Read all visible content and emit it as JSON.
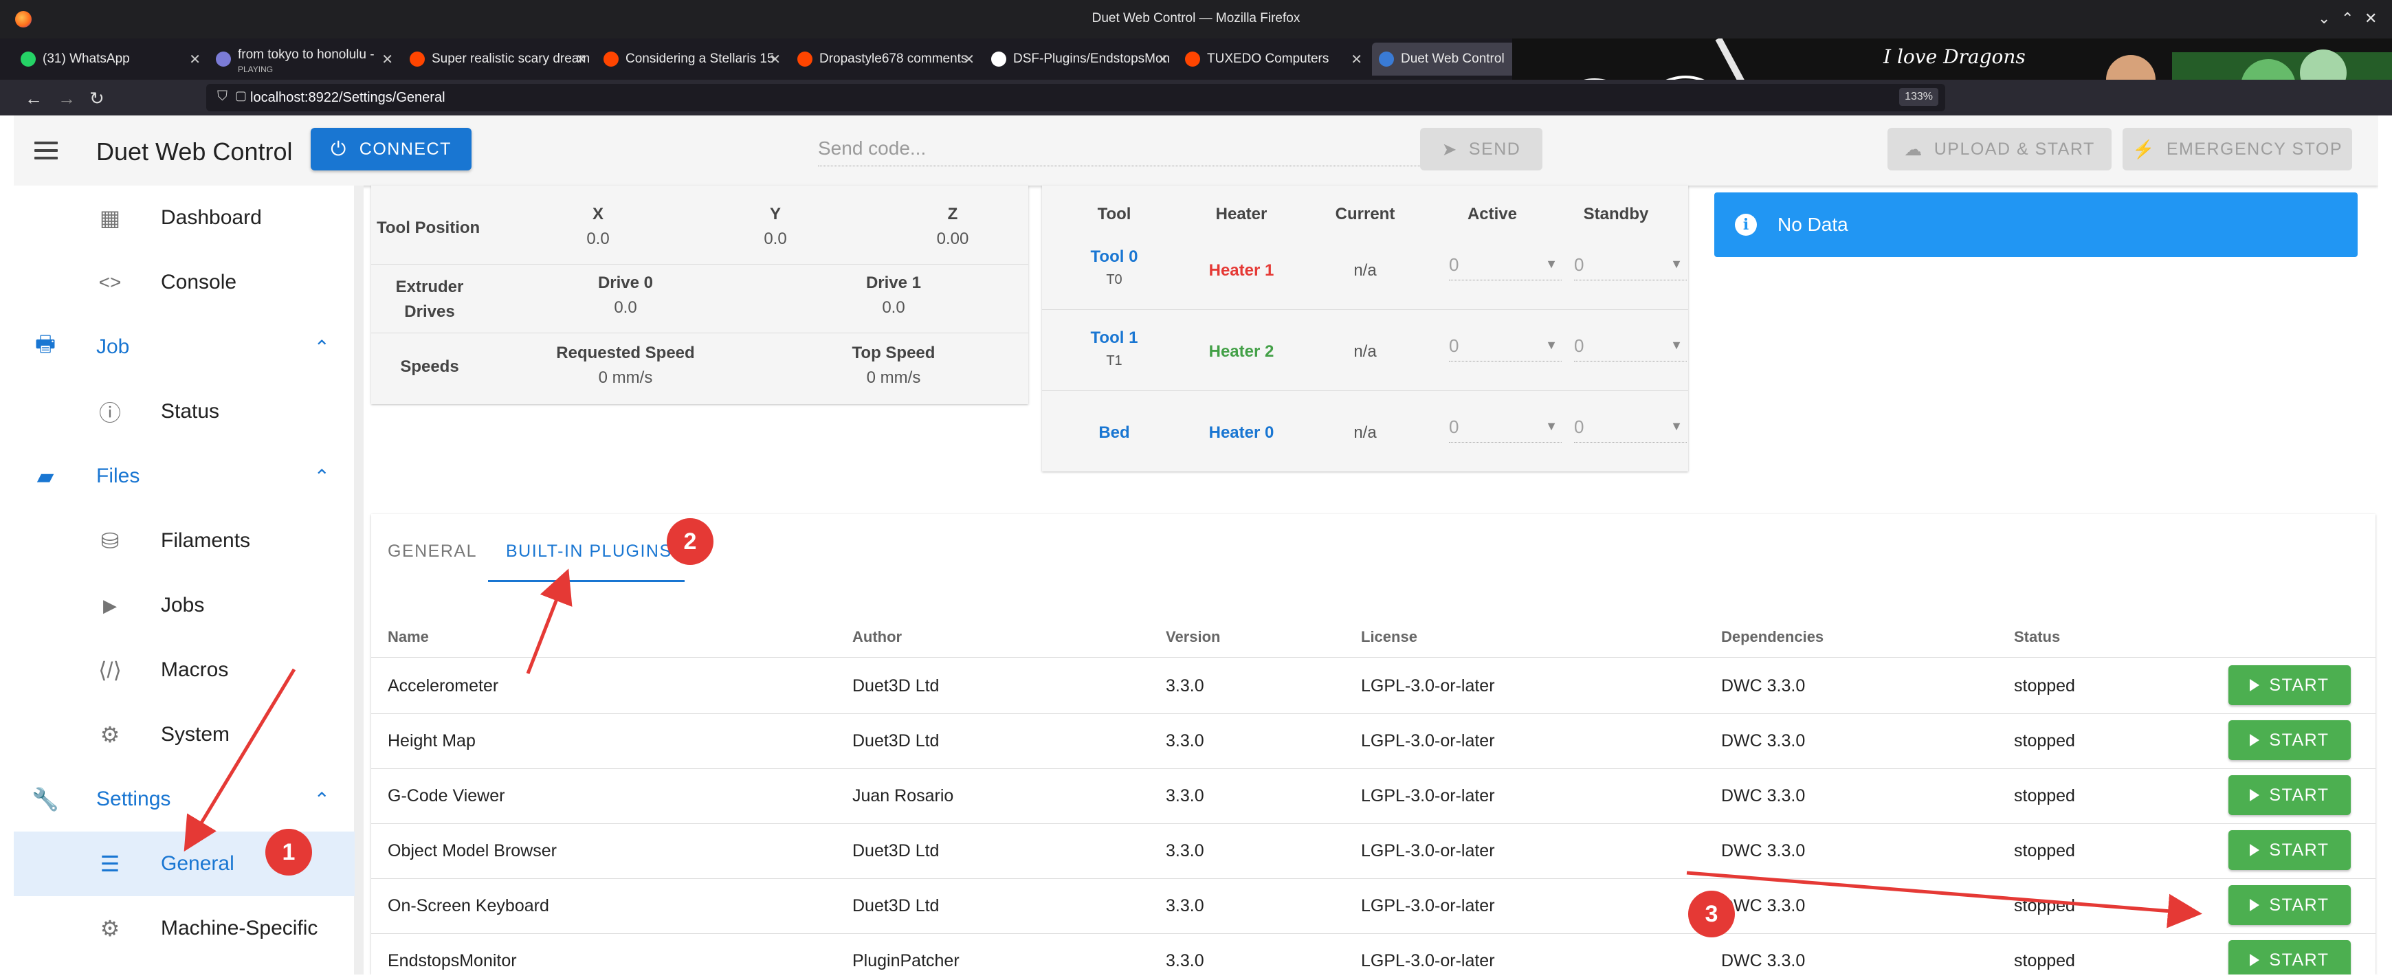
{
  "window": {
    "title": "Duet Web Control — Mozilla Firefox"
  },
  "tabs": [
    {
      "title": "(31) WhatsApp",
      "color": "#25d366"
    },
    {
      "title": "from tokyo to honolulu -",
      "sub": "PLAYING",
      "color": "#7b7bd6"
    },
    {
      "title": "Super realistic scary dream",
      "color": "#ff4500"
    },
    {
      "title": "Considering a Stellaris 15",
      "color": "#ff4500"
    },
    {
      "title": "Dropastyle678 comments",
      "color": "#ff4500"
    },
    {
      "title": "DSF-Plugins/EndstopsMon",
      "color": "#ffffff"
    },
    {
      "title": "TUXEDO Computers",
      "color": "#ff4500"
    },
    {
      "title": "Duet Web Control",
      "color": "#3a7bd5"
    }
  ],
  "banner_text": "I love Dragons",
  "url": "localhost:8922/Settings/General",
  "zoom": "133%",
  "app": {
    "title": "Duet Web Control",
    "connect_label": "CONNECT",
    "send_placeholder": "Send code...",
    "send_label": "SEND",
    "upload_label": "UPLOAD & START",
    "estop_label": "EMERGENCY STOP"
  },
  "sidebar": {
    "dashboard": "Dashboard",
    "console": "Console",
    "job": "Job",
    "status": "Status",
    "files": "Files",
    "filaments": "Filaments",
    "jobs": "Jobs",
    "macros": "Macros",
    "system": "System",
    "settings": "Settings",
    "general": "General",
    "machine_specific": "Machine-Specific"
  },
  "movement": {
    "tool_position": "Tool Position",
    "x": "X",
    "y": "Y",
    "z": "Z",
    "x_val": "0.0",
    "y_val": "0.0",
    "z_val": "0.00",
    "extruder_drives": "Extruder Drives",
    "drive0": "Drive 0",
    "drive1": "Drive 1",
    "drive0_val": "0.0",
    "drive1_val": "0.0",
    "speeds": "Speeds",
    "requested_speed": "Requested Speed",
    "top_speed": "Top Speed",
    "requested_val": "0 mm/s",
    "top_val": "0 mm/s"
  },
  "tools": {
    "headers": [
      "Tool",
      "Heater",
      "Current",
      "Active",
      "Standby"
    ],
    "rows": [
      {
        "tool": "Tool 0",
        "sub": "T0",
        "heater": "Heater 1",
        "current": "n/a",
        "active": "0",
        "standby": "0"
      },
      {
        "tool": "Tool 1",
        "sub": "T1",
        "heater": "Heater 2",
        "current": "n/a",
        "active": "0",
        "standby": "0"
      },
      {
        "tool": "Bed",
        "sub": "",
        "heater": "Heater 0",
        "current": "n/a",
        "active": "0",
        "standby": "0"
      }
    ]
  },
  "alert": {
    "text": "No Data"
  },
  "settings_tabs": {
    "general": "GENERAL",
    "builtin": "BUILT-IN PLUGINS"
  },
  "plugins": {
    "headers": {
      "name": "Name",
      "author": "Author",
      "version": "Version",
      "license": "License",
      "dependencies": "Dependencies",
      "status": "Status"
    },
    "start_label": "START",
    "rows": [
      {
        "name": "Accelerometer",
        "author": "Duet3D Ltd",
        "version": "3.3.0",
        "license": "LGPL-3.0-or-later",
        "deps": "DWC 3.3.0",
        "status": "stopped"
      },
      {
        "name": "Height Map",
        "author": "Duet3D Ltd",
        "version": "3.3.0",
        "license": "LGPL-3.0-or-later",
        "deps": "DWC 3.3.0",
        "status": "stopped"
      },
      {
        "name": "G-Code Viewer",
        "author": "Juan Rosario",
        "version": "3.3.0",
        "license": "LGPL-3.0-or-later",
        "deps": "DWC 3.3.0",
        "status": "stopped"
      },
      {
        "name": "Object Model Browser",
        "author": "Duet3D Ltd",
        "version": "3.3.0",
        "license": "LGPL-3.0-or-later",
        "deps": "DWC 3.3.0",
        "status": "stopped"
      },
      {
        "name": "On-Screen Keyboard",
        "author": "Duet3D Ltd",
        "version": "3.3.0",
        "license": "LGPL-3.0-or-later",
        "deps": "DWC 3.3.0",
        "status": "stopped"
      },
      {
        "name": "EndstopsMonitor",
        "author": "PluginPatcher",
        "version": "3.3.0",
        "license": "LGPL-3.0-or-later",
        "deps": "DWC 3.3.0",
        "status": "stopped"
      }
    ]
  },
  "annotations": {
    "b1": "1",
    "b2": "2",
    "b3": "3"
  },
  "colors": {
    "primary": "#1976d2",
    "start_green": "#4caf50",
    "annotation_red": "#e53935"
  }
}
